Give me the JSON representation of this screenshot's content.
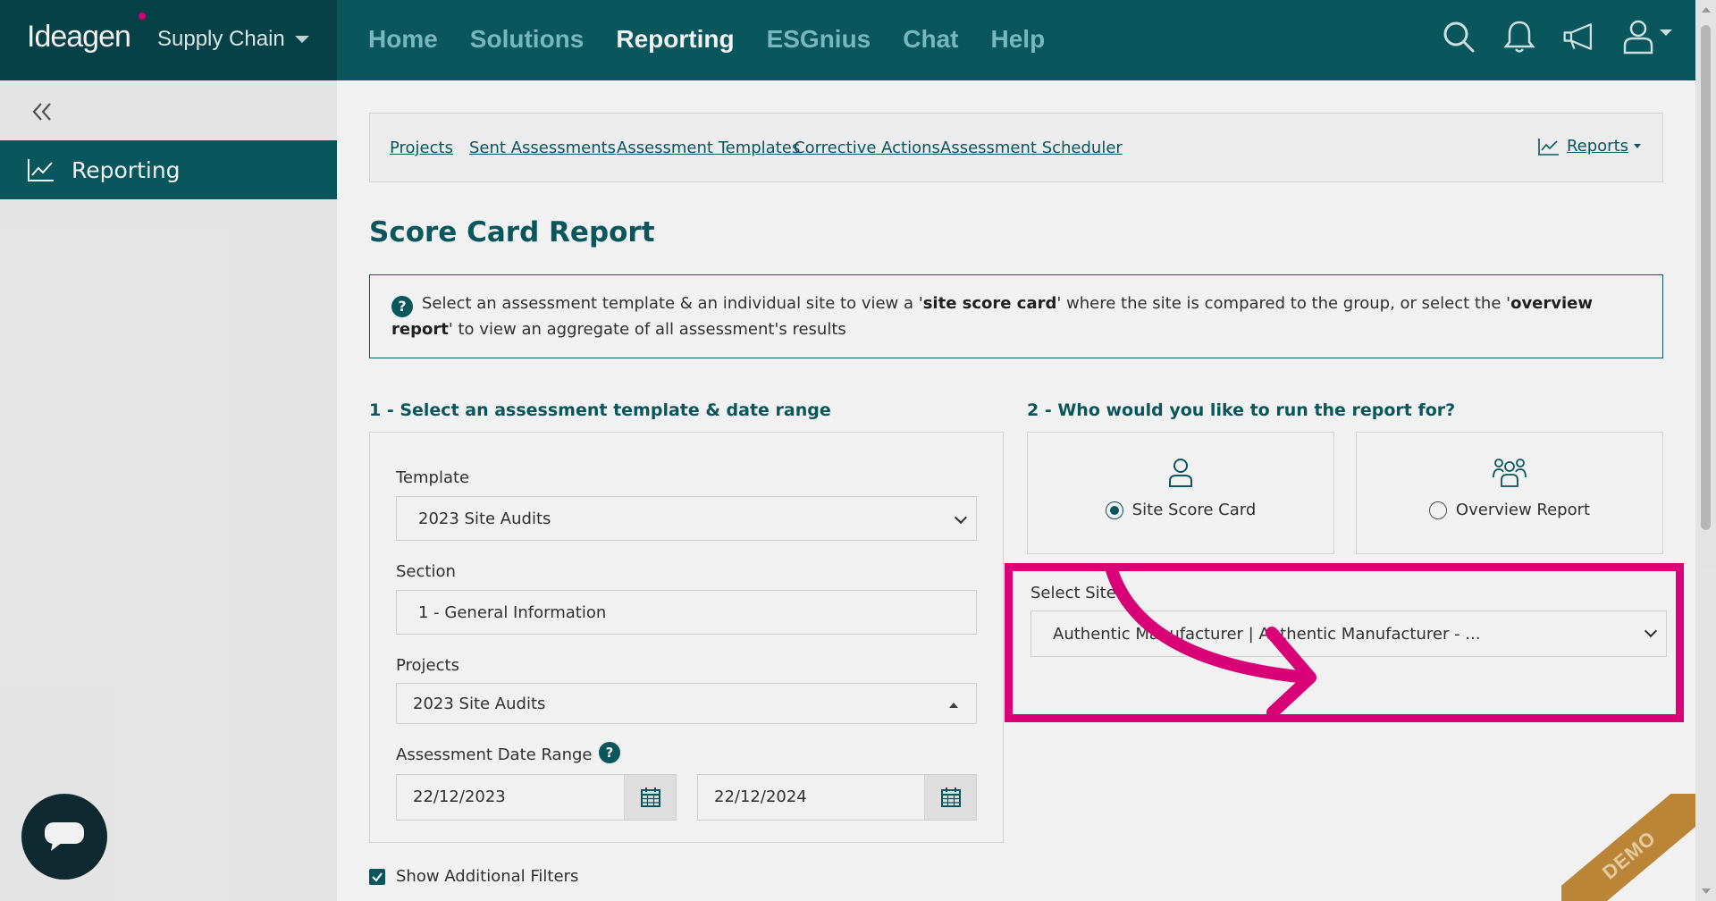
{
  "brand": {
    "logo": "Ideagen",
    "product": "Supply Chain"
  },
  "nav": {
    "home": "Home",
    "solutions": "Solutions",
    "reporting": "Reporting",
    "esgnius": "ESGnius",
    "chat": "Chat",
    "help": "Help"
  },
  "topicons": [
    "search-icon",
    "bell-icon",
    "megaphone-icon",
    "user-icon"
  ],
  "sidebar": {
    "item": "Reporting"
  },
  "tabs": {
    "projects": "Projects",
    "sent": "Sent Assessments",
    "templates": "Assessment Templates",
    "corrective": "Corrective Actions",
    "scheduler": "Assessment Scheduler",
    "reports": "Reports"
  },
  "page": {
    "title": "Score Card Report"
  },
  "info": {
    "t1": "Select an assessment template & an individual site to view a '",
    "b1": "site score card",
    "t2": "' where the site is compared to the group, or select the '",
    "b2": "overview report",
    "t3": "' to view an aggregate of all assessment's results"
  },
  "step1": {
    "heading": "1 - Select an assessment template & date range"
  },
  "step2": {
    "heading": "2 - Who would you like to run the report for?"
  },
  "form": {
    "template_label": "Template",
    "template_value": "2023 Site Audits",
    "section_label": "Section",
    "section_value": "1 - General Information",
    "projects_label": "Projects",
    "projects_value": "2023 Site Audits",
    "date_label": "Assessment Date Range",
    "date_from": "22/12/2023",
    "date_to": "22/12/2024"
  },
  "options": {
    "site": "Site Score Card",
    "overview": "Overview Report",
    "selected": "site"
  },
  "site": {
    "label": "Select Site",
    "value": "Authentic Manufacturer | Authentic Manufacturer - ..."
  },
  "filters": {
    "label": "Show Additional Filters",
    "checked": true
  },
  "demo": "DEMO",
  "colors": {
    "primary": "#0a5b63",
    "highlight": "#e6007e"
  }
}
